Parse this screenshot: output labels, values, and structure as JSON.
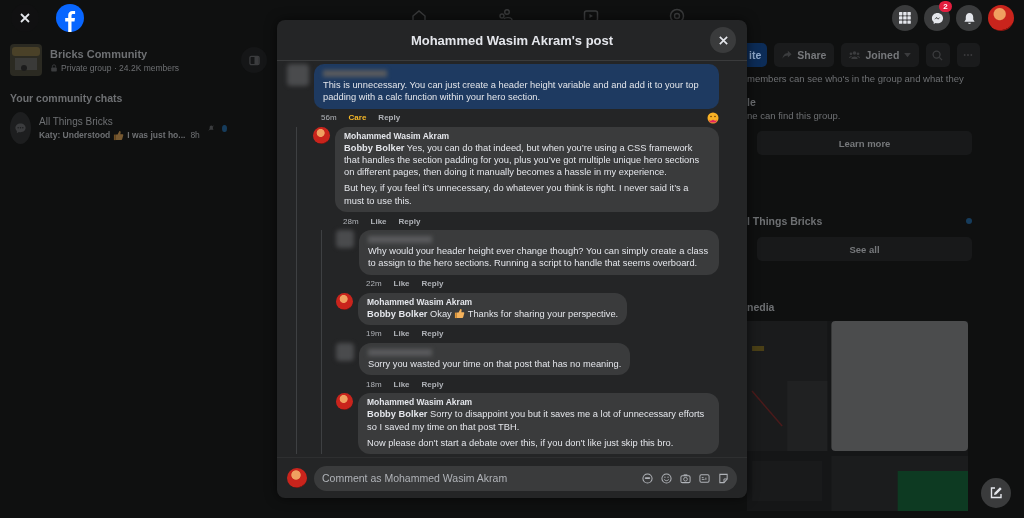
{
  "top_bar": {
    "messenger_badge": "2"
  },
  "sidebar": {
    "group_name": "Bricks Community",
    "group_meta": "Private group · 24.2K members",
    "chats_heading": "Your community chats",
    "chats": [
      {
        "name": "All Things Bricks",
        "preview": [
          {
            "text": "Katy: Understood"
          },
          {
            "kind": "thumb"
          },
          {
            "text": "I was just ho..."
          }
        ],
        "time": "8h",
        "muted": true,
        "unread": true
      }
    ]
  },
  "group_panel": {
    "actions": [
      {
        "kind": "invite",
        "label": "ite"
      },
      {
        "kind": "share",
        "label": "Share"
      },
      {
        "kind": "joined",
        "label": "Joined"
      },
      {
        "kind": "search"
      },
      {
        "kind": "more"
      }
    ],
    "privacy_text": "members can see who's in the group and what they",
    "visibility_title": "le",
    "visibility_text": "ne can find this group.",
    "learn_more": "Learn more",
    "chat_name": "l Things Bricks",
    "chat_unread": true,
    "see_all": "See all",
    "media_title": "nedia"
  },
  "post_dialog": {
    "title": "Mohammed Wasim Akram's post",
    "comments": [
      {
        "highlighted": true,
        "paragraphs": [
          [
            {
              "text": "This is unnecessary. You can just create a header height variable and and add it to your top padding with a calc function within your hero section."
            }
          ]
        ],
        "time": "56m",
        "reaction": "Care",
        "reacted": true,
        "reply": "Reply",
        "children": [
          {
            "author": "Mohammed Wasim Akram",
            "highlighted": false,
            "paragraphs": [
              [
                {
                  "text": "**Bobby Bolker** Yes, you can do that indeed, but when you’re using a CSS framework that handles the section padding for you, plus you’ve got multiple unique hero sections on different pages, then doing it manually becomes a hassle in my experience."
                }
              ],
              [
                {
                  "text": "But hey, if you feel it’s unnecessary, do whatever you think is right. I never said it’s a must to use this."
                }
              ]
            ],
            "time": "28m",
            "reaction": "Like",
            "reacted": false,
            "reply": "Reply",
            "children": [
              {
                "highlighted": false,
                "paragraphs": [
                  [
                    {
                      "text": "Why would your header height ever change though? You can simply create a class to assign to the hero sections. Running a script to handle that seems overboard."
                    }
                  ]
                ],
                "time": "22m",
                "reaction": "Like",
                "reacted": false,
                "reply": "Reply"
              },
              {
                "author": "Mohammed Wasim Akram",
                "highlighted": false,
                "paragraphs": [
                  [
                    {
                      "text": "**Bobby Bolker** Okay"
                    },
                    {
                      "kind": "thumb"
                    },
                    {
                      "text": "Thanks for sharing your perspective."
                    }
                  ]
                ],
                "time": "19m",
                "reaction": "Like",
                "reacted": false,
                "reply": "Reply"
              },
              {
                "highlighted": false,
                "paragraphs": [
                  [
                    {
                      "text": "Sorry you wasted your time on that post that has no meaning."
                    }
                  ]
                ],
                "time": "18m",
                "reaction": "Like",
                "reacted": false,
                "reply": "Reply"
              },
              {
                "author": "Mohammed Wasim Akram",
                "highlighted": false,
                "paragraphs": [
                  [
                    {
                      "text": "**Bobby Bolker** Sorry to disappoint you but it saves me a lot of unnecessary efforts so I saved my time on that post TBH."
                    }
                  ],
                  [
                    {
                      "text": "Now please don't start a debate over this, if you don't like just skip this bro."
                    }
                  ]
                ]
              }
            ]
          }
        ]
      }
    ],
    "composer": {
      "placeholder": "Comment as Mohammed Wasim Akram"
    }
  }
}
